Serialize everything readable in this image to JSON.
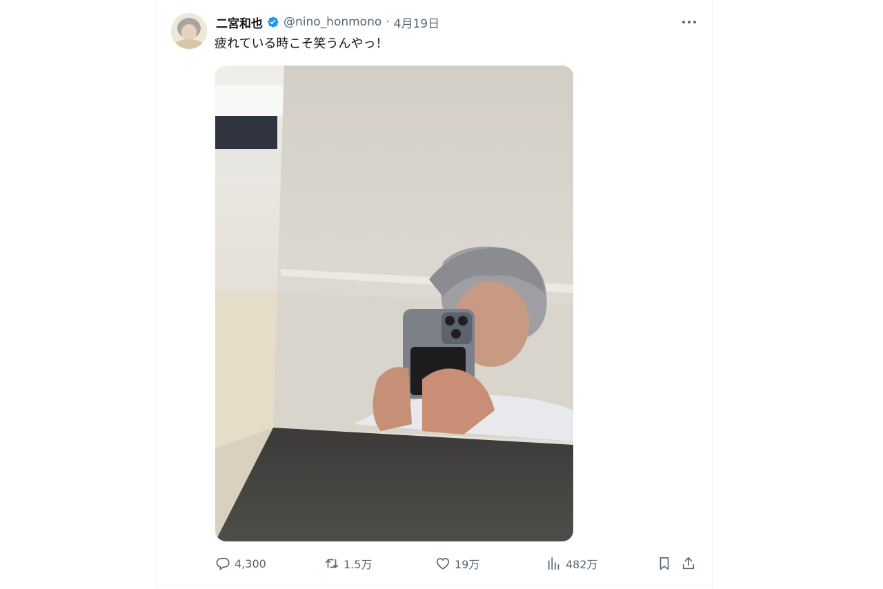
{
  "tweet": {
    "author_name": "二宮和也",
    "verified": true,
    "handle": "@nino_honmono",
    "separator": "·",
    "date": "4月19日",
    "text": "疲れている時こそ笑うんやっ！"
  },
  "actions": {
    "replies": "4,300",
    "reposts": "1.5万",
    "likes": "19万",
    "views": "482万"
  },
  "icons": {
    "verified": "verified-badge-icon",
    "more": "more-dots-icon",
    "reply": "reply-icon",
    "repost": "repost-icon",
    "like": "heart-icon",
    "views": "bar-chart-icon",
    "bookmark": "bookmark-icon",
    "share": "share-icon"
  },
  "colors": {
    "verified_blue": "#1d9bf0",
    "text_primary": "#0f1419",
    "text_secondary": "#536471"
  }
}
